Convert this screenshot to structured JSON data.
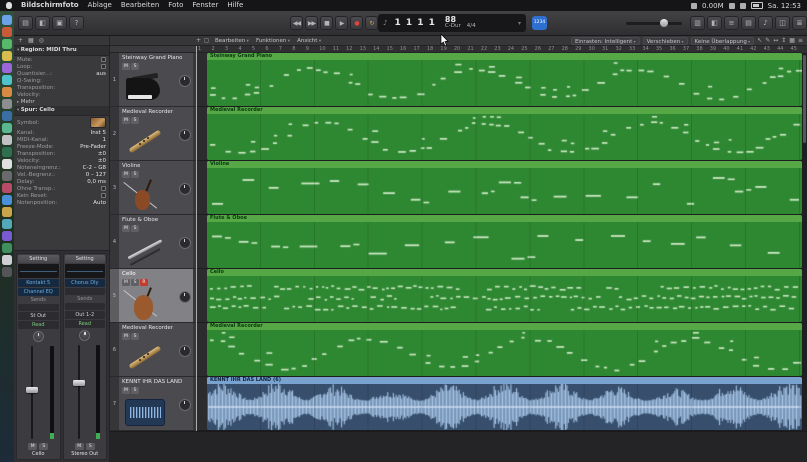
{
  "menubar": {
    "items": [
      "Bildschirmfoto",
      "Ablage",
      "Bearbeiten",
      "Foto",
      "Fenster",
      "Hilfe"
    ],
    "net": "0.00M",
    "time": "Sa. 12:53"
  },
  "dock_colors": [
    "#6aa2e8",
    "#c85a3a",
    "#58b86a",
    "#d8bc4e",
    "#9a66d8",
    "#4fc2cc",
    "#d88a44",
    "#8e8e92",
    "#3a6ea5",
    "#5ab890",
    "#c2c2c6",
    "#2f6f4f",
    "#e0e0e2",
    "#6a6a6e",
    "#b84a6a",
    "#4a90d9",
    "#caa44a",
    "#52a8b8",
    "#7a5ad0",
    "#3f8f5f",
    "#d0d0d4",
    "#555559"
  ],
  "toolbar": {
    "left_icons": [
      {
        "name": "library-icon",
        "glyph": "▤"
      },
      {
        "name": "inspector-icon",
        "glyph": "◧"
      },
      {
        "name": "toolbar-settings-icon",
        "glyph": "▣"
      },
      {
        "name": "quick-help-icon",
        "glyph": "?"
      }
    ],
    "transport": [
      {
        "name": "rewind-button",
        "glyph": "◀◀"
      },
      {
        "name": "forward-button",
        "glyph": "▶▶"
      },
      {
        "name": "stop-button",
        "glyph": "■"
      },
      {
        "name": "play-button",
        "glyph": "▶"
      },
      {
        "name": "record-button",
        "glyph": "●"
      },
      {
        "name": "cycle-button",
        "glyph": "↻"
      }
    ],
    "lcd": {
      "icon": "♪",
      "position": "1 1 1 1",
      "tempo": "88",
      "key": "C-Dur",
      "timesig": "4/4",
      "dropdown": "▾"
    },
    "countin_label": "1234",
    "right_icons": [
      {
        "name": "mixer-icon",
        "glyph": "▥"
      },
      {
        "name": "editors-icon",
        "glyph": "◧"
      },
      {
        "name": "smart-controls-icon",
        "glyph": "≡"
      },
      {
        "name": "note-pad-icon",
        "glyph": "▤"
      },
      {
        "name": "apple-loops-icon",
        "glyph": "♪"
      },
      {
        "name": "browsers-icon",
        "glyph": "◫"
      },
      {
        "name": "list-editors-icon",
        "glyph": "≣"
      }
    ]
  },
  "arrangebar": {
    "inspector_tools": [
      {
        "name": "add-icon",
        "glyph": "+"
      },
      {
        "name": "library-grid-icon",
        "glyph": "▦"
      },
      {
        "name": "settings-icon",
        "glyph": "◎"
      }
    ],
    "lane_tools": [
      {
        "name": "add-track-button",
        "glyph": "+"
      },
      {
        "name": "duplicate-track-button",
        "glyph": "◻"
      }
    ],
    "menus": [
      {
        "label": "Bearbeiten"
      },
      {
        "label": "Funktionen"
      },
      {
        "label": "Ansicht"
      }
    ],
    "snap": {
      "label": "Einrasten:",
      "value": "Intelligent"
    },
    "drag": {
      "label": "Verschieben",
      "value": "Keine Überlappung"
    },
    "tools": [
      {
        "name": "pointer-tool-icon",
        "glyph": "↖"
      },
      {
        "name": "pencil-tool-icon",
        "glyph": "✎"
      }
    ],
    "zoom_icons": [
      {
        "name": "zoom-horizontal-icon",
        "glyph": "↔"
      },
      {
        "name": "zoom-vertical-icon",
        "glyph": "↕"
      },
      {
        "name": "waveform-zoom-icon",
        "glyph": "▦"
      },
      {
        "name": "view-options-icon",
        "glyph": "≡"
      }
    ]
  },
  "ruler": {
    "bars": 45
  },
  "inspector": {
    "region": {
      "title": "Region: MIDI Thru",
      "rows": [
        {
          "label": "Mute:",
          "value": "",
          "checkbox": true
        },
        {
          "label": "Loop:",
          "value": "",
          "checkbox": true
        },
        {
          "label": "Quantisier...:",
          "value": "aus"
        },
        {
          "label": "Q-Swing:",
          "value": ""
        },
        {
          "label": "Transposition:",
          "value": ""
        },
        {
          "label": "Velocity:",
          "value": ""
        }
      ],
      "more": "Mehr"
    },
    "track": {
      "title": "Spur: Cello",
      "rows": [
        {
          "label": "Symbol:",
          "value": "",
          "thumb": true
        },
        {
          "label": "Kanal:",
          "value": "Inst 5"
        },
        {
          "label": "MIDI-Kanal:",
          "value": "1"
        },
        {
          "label": "Freeze-Mode:",
          "value": "Pre-Fader"
        },
        {
          "label": "Transposition:",
          "value": "±0"
        },
        {
          "label": "Velocity:",
          "value": "±0"
        },
        {
          "label": "Noteneingrenz.:",
          "value": "C-2 – G8"
        },
        {
          "label": "Vel.-Begrenz.:",
          "value": "0 – 127"
        },
        {
          "label": "Delay:",
          "value": "0,0 ms"
        },
        {
          "label": "Ohne Transp.:",
          "value": "",
          "checkbox": true
        },
        {
          "label": "Kein Reset:",
          "value": "",
          "checkbox": true
        },
        {
          "label": "Notenposition:",
          "value": "Auto"
        }
      ]
    },
    "strips": [
      {
        "setting": "Setting",
        "inserts": [
          "Kontakt 5",
          "Channel EQ"
        ],
        "sends_label": "Sends",
        "output": "St Out",
        "automation": "Read",
        "ms": [
          "M",
          "S"
        ],
        "name": "Cello"
      },
      {
        "setting": "Setting",
        "inserts": [
          "Chorus Dly"
        ],
        "sends_label": "Sends",
        "output": "Out 1-2",
        "automation": "Read",
        "ms": [
          "M",
          "S"
        ],
        "name": "Stereo Out"
      }
    ]
  },
  "tracks": [
    {
      "num": "1",
      "name": "Steinway Grand Piano",
      "icon": "piano",
      "buttons": [
        "M",
        "S"
      ],
      "selected": false,
      "region": {
        "label": "Steinway Grand Piano",
        "type": "midi",
        "pattern": "melody"
      }
    },
    {
      "num": "2",
      "name": "Medieval Recorder",
      "icon": "recorder",
      "buttons": [
        "M",
        "S"
      ],
      "selected": false,
      "region": {
        "label": "Medieval Recorder",
        "type": "midi",
        "pattern": "melody"
      }
    },
    {
      "num": "3",
      "name": "Violine",
      "icon": "violin",
      "buttons": [
        "M",
        "S"
      ],
      "selected": false,
      "region": {
        "label": "Violine",
        "type": "midi",
        "pattern": "sparse"
      }
    },
    {
      "num": "4",
      "name": "Flute & Oboe",
      "icon": "flute",
      "buttons": [
        "M",
        "S"
      ],
      "selected": false,
      "region": {
        "label": "Flute & Oboe",
        "type": "midi",
        "pattern": "sparse"
      }
    },
    {
      "num": "5",
      "name": "Cello",
      "icon": "cello",
      "buttons": [
        "M",
        "S",
        "R"
      ],
      "selected": true,
      "region": {
        "label": "Cello",
        "type": "midi",
        "pattern": "dense"
      }
    },
    {
      "num": "6",
      "name": "Medieval Recorder",
      "icon": "recorder",
      "buttons": [
        "M",
        "S"
      ],
      "selected": false,
      "region": {
        "label": "Medieval Recorder",
        "type": "midi",
        "pattern": "melody"
      }
    },
    {
      "num": "7",
      "name": "KENNT IHR DAS LAND",
      "icon": "audio",
      "buttons": [
        "M",
        "S"
      ],
      "selected": false,
      "region": {
        "label": "KENNT IHR DAS LAND (6)",
        "type": "audio"
      }
    }
  ],
  "colors": {
    "midi_region": "#2e8832",
    "midi_region_header": "#56a847",
    "audio_region": "#374f6d",
    "audio_region_header": "#7aa2cf",
    "record_red": "#e04438",
    "insert_blue": "#6cb0e8",
    "countin_blue": "#2f6fd0"
  }
}
